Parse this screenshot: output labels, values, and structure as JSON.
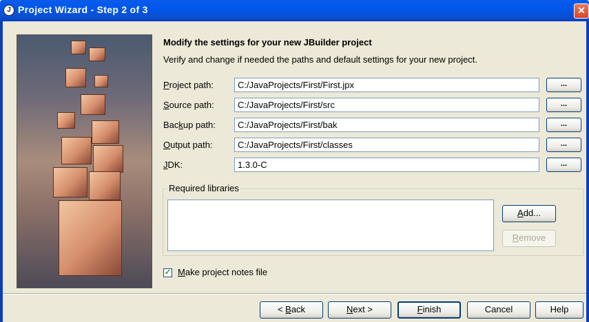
{
  "window": {
    "title": "Project Wizard - Step 2 of 3",
    "close_glyph": "✕",
    "icon_glyph": "J"
  },
  "content": {
    "heading": "Modify the settings for your new JBuilder project",
    "subheading": "Verify and change if needed the paths and default settings for your new project."
  },
  "fields": [
    {
      "label_pre": "",
      "label_u": "P",
      "label_post": "roject path:",
      "value": "C:/JavaProjects/First/First.jpx",
      "browse": "..."
    },
    {
      "label_pre": "",
      "label_u": "S",
      "label_post": "ource path:",
      "value": "C:/JavaProjects/First/src",
      "browse": "..."
    },
    {
      "label_pre": "Bac",
      "label_u": "k",
      "label_post": "up path:",
      "value": "C:/JavaProjects/First/bak",
      "browse": "..."
    },
    {
      "label_pre": "",
      "label_u": "O",
      "label_post": "utput path:",
      "value": "C:/JavaProjects/First/classes",
      "browse": "..."
    },
    {
      "label_pre": "",
      "label_u": "J",
      "label_post": "DK:",
      "value": "1.3.0-C",
      "browse": "..."
    }
  ],
  "libraries": {
    "group_label": "Required libraries",
    "add": {
      "pre": "",
      "u": "A",
      "post": "dd..."
    },
    "remove": {
      "pre": "",
      "u": "R",
      "post": "emove"
    }
  },
  "notes": {
    "checked": true,
    "check_glyph": "✓",
    "label_pre": "",
    "label_u": "M",
    "label_post": "ake project notes file"
  },
  "footer": {
    "back": {
      "pre": "< ",
      "u": "B",
      "post": "ack"
    },
    "next": {
      "pre": "",
      "u": "N",
      "post": "ext >"
    },
    "finish": {
      "pre": "",
      "u": "F",
      "post": "inish"
    },
    "cancel": "Cancel",
    "help": "Help"
  },
  "colors": {
    "titlebar": "#0058EE",
    "close": "#D6452A",
    "dialog_bg": "#ECE9D8"
  }
}
